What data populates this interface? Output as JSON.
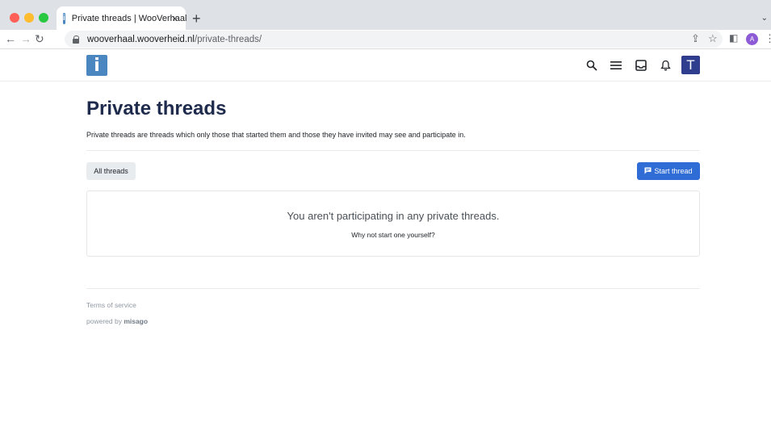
{
  "browser": {
    "tab_title": "Private threads | WooVerhaal",
    "tab_favicon_letter": "i",
    "tab_close": "×",
    "new_tab": "+",
    "tab_menu": "⌄",
    "url_host": "wooverhaal.wooverheid.nl",
    "url_path": "/private-threads/",
    "profile_initial": "A"
  },
  "header": {
    "logo_letter": "i",
    "avatar_initial": "T",
    "icons": [
      "search-icon",
      "menu-icon",
      "inbox-icon",
      "bell-icon"
    ]
  },
  "main": {
    "title": "Private threads",
    "description": "Private threads are threads which only those that started them and those they have invited may see and participate in.",
    "all_threads_label": "All threads",
    "start_thread_label": "Start thread",
    "blank_message": "You aren't participating in any private threads.",
    "blank_sub": "Why not start one yourself?"
  },
  "footer": {
    "terms": "Terms of service",
    "powered_prefix": "powered by ",
    "powered_brand": "misago"
  },
  "colors": {
    "brand": "#4a86c0",
    "primary_button": "#2f6cd6",
    "avatar": "#2f3d8f",
    "title": "#1f2b4d"
  }
}
